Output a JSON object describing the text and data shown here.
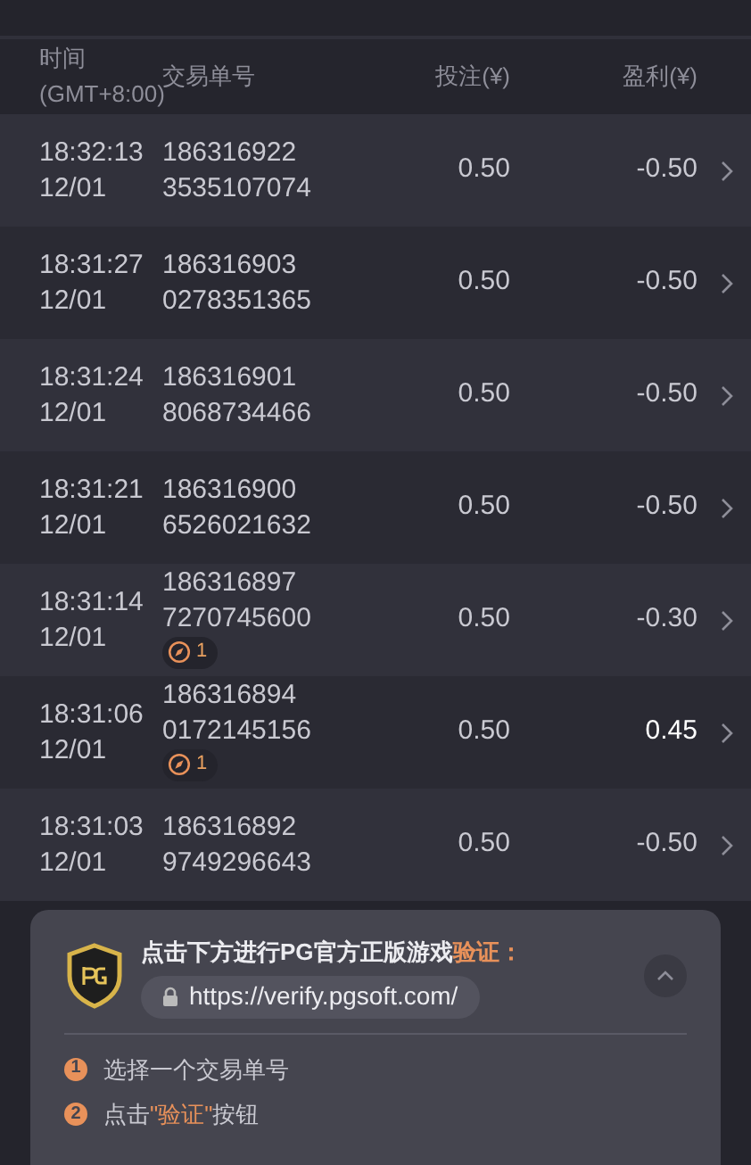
{
  "table": {
    "columns": [
      {
        "lines": [
          "时间",
          "(GMT+8:00)"
        ]
      },
      {
        "lines": [
          "交易单号"
        ]
      },
      {
        "lines": [
          "投注(¥)"
        ]
      },
      {
        "lines": [
          "盈利(¥)"
        ]
      }
    ],
    "rows": [
      {
        "time": "18:32:13",
        "date": "12/01",
        "id_1": "186316922",
        "id_2": "3535107074",
        "bet": "0.50",
        "profit": "-0.50",
        "positive": false
      },
      {
        "time": "18:31:27",
        "date": "12/01",
        "id_1": "186316903",
        "id_2": "0278351365",
        "bet": "0.50",
        "profit": "-0.50",
        "positive": false
      },
      {
        "time": "18:31:24",
        "date": "12/01",
        "id_1": "186316901",
        "id_2": "8068734466",
        "bet": "0.50",
        "profit": "-0.50",
        "positive": false
      },
      {
        "time": "18:31:21",
        "date": "12/01",
        "id_1": "186316900",
        "id_2": "6526021632",
        "bet": "0.50",
        "profit": "-0.50",
        "positive": false
      },
      {
        "time": "18:31:14",
        "date": "12/01",
        "id_1": "186316897",
        "id_2": "7270745600",
        "badge": "1",
        "bet": "0.50",
        "profit": "-0.30",
        "positive": false
      },
      {
        "time": "18:31:06",
        "date": "12/01",
        "id_1": "186316894",
        "id_2": "0172145156",
        "badge": "1",
        "bet": "0.50",
        "profit": "0.45",
        "positive": true
      },
      {
        "time": "18:31:03",
        "date": "12/01",
        "id_1": "186316892",
        "id_2": "9749296643",
        "bet": "0.50",
        "profit": "-0.50",
        "positive": false
      }
    ]
  },
  "verify_panel": {
    "title": [
      {
        "text": "点击下方进行PG官方正版游戏",
        "accent": false
      },
      {
        "text": "验证：",
        "accent": true
      }
    ],
    "url": "https://verify.pgsoft.com/",
    "expanded": true,
    "steps": [
      {
        "number": "1",
        "parts": [
          {
            "text": "选择一个交易单号",
            "accent": false
          }
        ]
      },
      {
        "number": "2",
        "parts": [
          {
            "text": "点击",
            "accent": false
          },
          {
            "text": "\"验证\"",
            "accent": true
          },
          {
            "text": "按钮",
            "accent": false
          }
        ]
      }
    ]
  }
}
